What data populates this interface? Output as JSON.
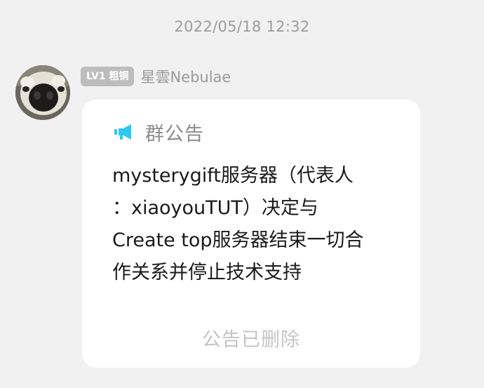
{
  "timestamp": "2022/05/18 12:32",
  "sender": {
    "level_badge": "LV1 粗铜",
    "name": "星雲Nebulae",
    "avatar_icon": "alpaca-avatar"
  },
  "announcement": {
    "icon": "megaphone-icon",
    "icon_color": "#2ec8f0",
    "title": "群公告",
    "body": "mysterygift服务器（代表人\n：xiaoyouTUT）决定与\nCreate top服务器结束一切合\n作关系并停止技术支持",
    "status": "公告已删除"
  }
}
